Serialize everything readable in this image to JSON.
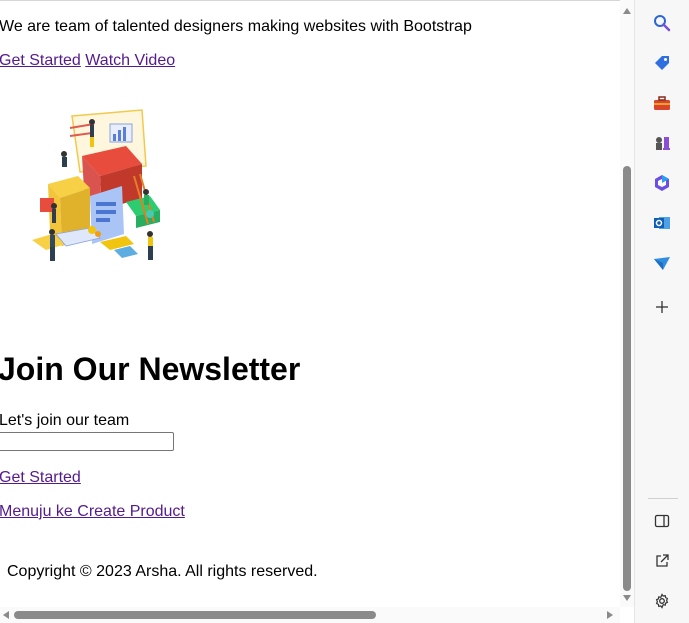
{
  "hero": {
    "tagline": "We are team of talented designers making websites with Bootstrap",
    "get_started": "Get Started",
    "watch_video": "Watch Video"
  },
  "newsletter": {
    "title": "Join Our Newsletter",
    "label": "Let's join our team",
    "email_value": "",
    "cta": "Get Started",
    "create_product": "Menuju ke Create Product"
  },
  "footer": {
    "copyright": "Copyright © 2023 Arsha. All rights reserved."
  },
  "sidebar": {
    "icons": [
      "search-icon",
      "tag-icon",
      "toolbox-icon",
      "chess-icon",
      "copilot-icon",
      "outlook-icon",
      "send-icon",
      "add-icon",
      "split-pane-icon",
      "open-external-icon",
      "settings-icon"
    ]
  },
  "colors": {
    "link": "#551a8b",
    "scrollbar": "#8a8a8a",
    "sidebar_bg": "#f7f7f7"
  }
}
